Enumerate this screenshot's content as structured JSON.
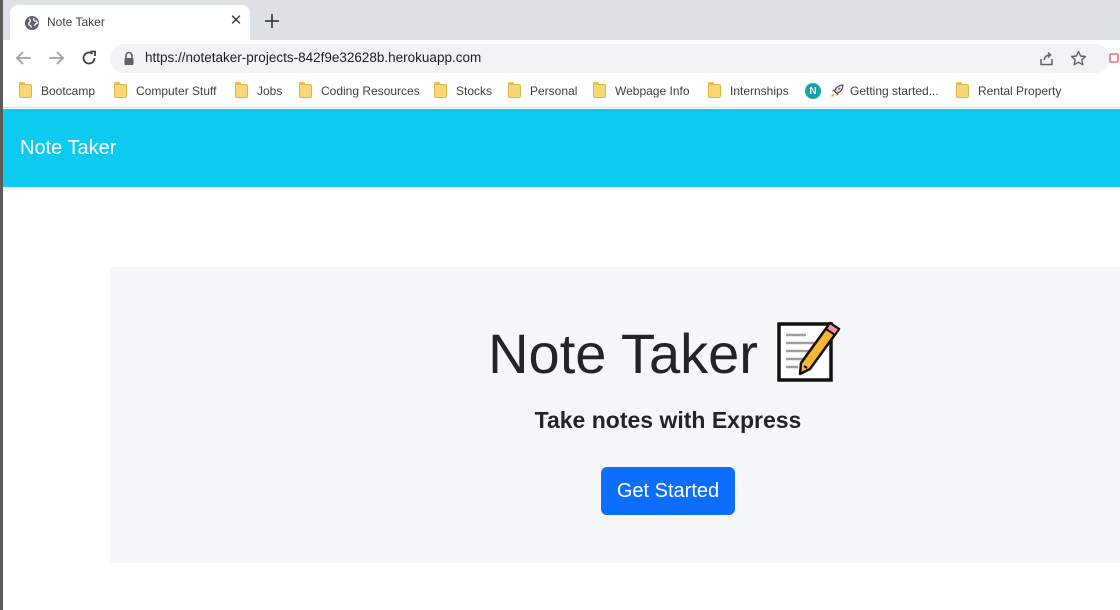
{
  "browser": {
    "tab": {
      "title": "Note Taker"
    },
    "address_bar": {
      "url": "https://notetaker-projects-842f9e32628b.herokuapp.com"
    },
    "bookmarks": [
      {
        "label": "Bootcamp",
        "icon": "folder-icon"
      },
      {
        "label": "Computer Stuff",
        "icon": "folder-icon"
      },
      {
        "label": "Jobs",
        "icon": "folder-icon"
      },
      {
        "label": "Coding Resources",
        "icon": "folder-icon"
      },
      {
        "label": "Stocks",
        "icon": "folder-icon"
      },
      {
        "label": "Personal",
        "icon": "folder-icon"
      },
      {
        "label": "Webpage Info",
        "icon": "folder-icon"
      },
      {
        "label": "Internships",
        "icon": "folder-icon"
      },
      {
        "label": "N",
        "icon": "notion-icon"
      },
      {
        "label": "Getting started...",
        "icon": "rocket-icon"
      },
      {
        "label": "Rental Property",
        "icon": "folder-icon"
      }
    ]
  },
  "page": {
    "navbar": {
      "brand": "Note Taker",
      "color": "#0dcaf0"
    },
    "hero": {
      "title": "Note Taker",
      "title_icon": "memo-icon",
      "subtitle": "Take notes with Express",
      "button_label": "Get Started",
      "button_color": "#0d6efd"
    }
  }
}
